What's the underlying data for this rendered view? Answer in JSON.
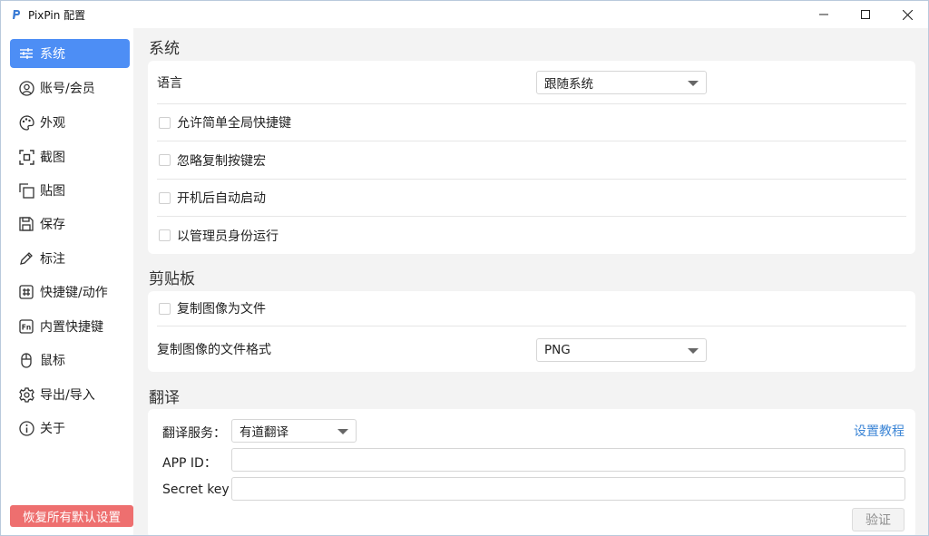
{
  "window": {
    "title": "PixPin 配置"
  },
  "sidebar": {
    "items": [
      {
        "label": "系统",
        "icon": "sliders-icon",
        "active": true
      },
      {
        "label": "账号/会员",
        "icon": "user-icon"
      },
      {
        "label": "外观",
        "icon": "palette-icon"
      },
      {
        "label": "截图",
        "icon": "screenshot-icon"
      },
      {
        "label": "贴图",
        "icon": "pin-image-icon"
      },
      {
        "label": "保存",
        "icon": "save-icon"
      },
      {
        "label": "标注",
        "icon": "pencil-icon"
      },
      {
        "label": "快捷键/动作",
        "icon": "hotkey-icon"
      },
      {
        "label": "内置快捷键",
        "icon": "fn-key-icon"
      },
      {
        "label": "鼠标",
        "icon": "mouse-icon"
      },
      {
        "label": "导出/导入",
        "icon": "gear-icon"
      },
      {
        "label": "关于",
        "icon": "info-icon"
      }
    ],
    "reset_label": "恢复所有默认设置"
  },
  "system": {
    "title": "系统",
    "language_label": "语言",
    "language_value": "跟随系统",
    "options": [
      {
        "label": "允许简单全局快捷键",
        "checked": false
      },
      {
        "label": "忽略复制按键宏",
        "checked": false
      },
      {
        "label": "开机后自动启动",
        "checked": false
      },
      {
        "label": "以管理员身份运行",
        "checked": false
      }
    ]
  },
  "clipboard": {
    "title": "剪贴板",
    "copy_as_file_label": "复制图像为文件",
    "copy_as_file_checked": false,
    "format_label": "复制图像的文件格式",
    "format_value": "PNG"
  },
  "translate": {
    "title": "翻译",
    "service_label": "翻译服务：",
    "service_value": "有道翻译",
    "tutorial_link": "设置教程",
    "app_id_label": "APP ID：",
    "app_id_value": "",
    "secret_key_label": "Secret key",
    "secret_key_value": "",
    "verify_label": "验证"
  },
  "colors": {
    "accent": "#4d8ef5",
    "danger": "#ee6f6f",
    "link": "#3d86d6"
  }
}
